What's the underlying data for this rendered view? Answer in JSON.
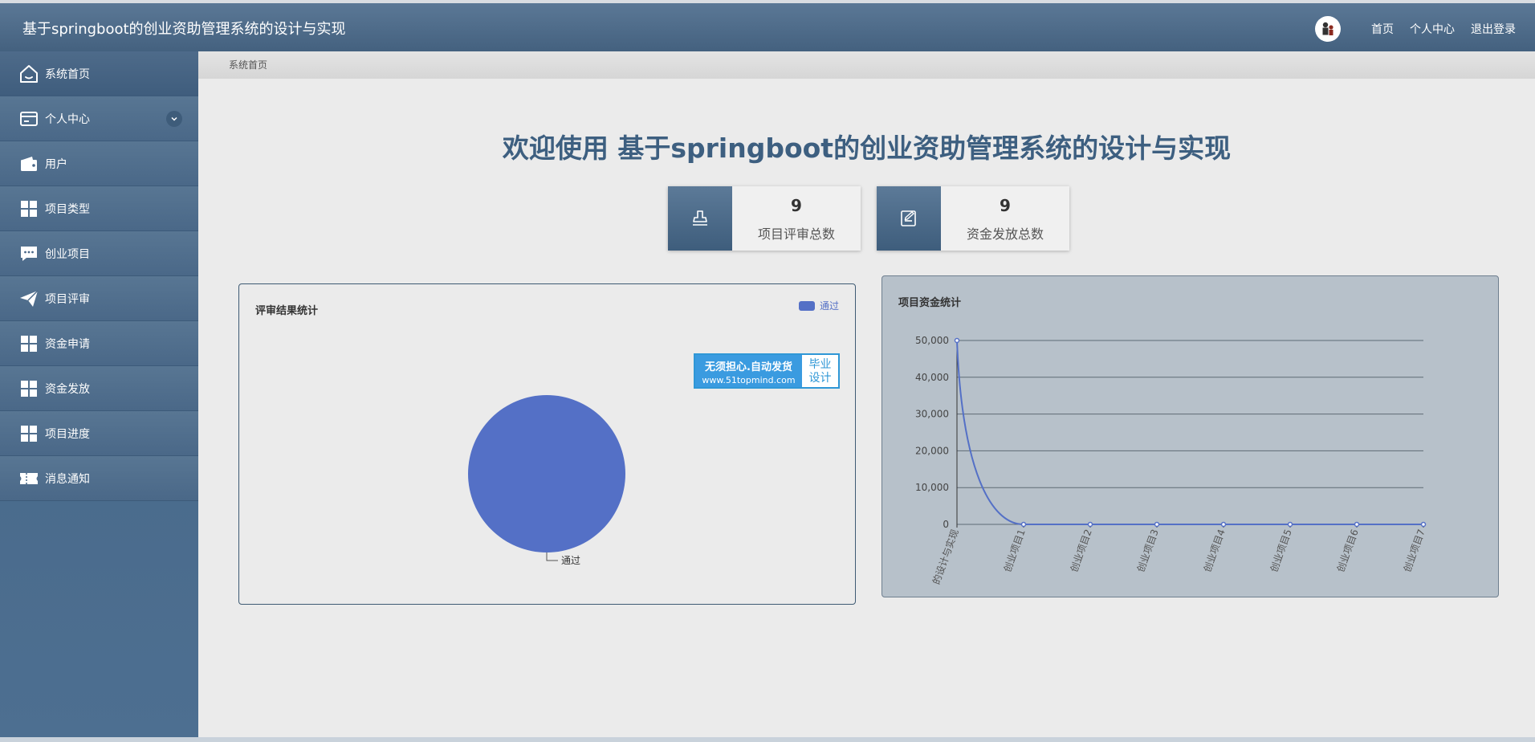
{
  "header": {
    "app_title": "基于springboot的创业资助管理系统的设计与实现",
    "nav": {
      "home": "首页",
      "profile": "个人中心",
      "logout": "退出登录"
    }
  },
  "sidebar": {
    "items": [
      {
        "label": "系统首页",
        "icon": "home-icon"
      },
      {
        "label": "个人中心",
        "icon": "card-icon",
        "expandable": true
      },
      {
        "label": "用户",
        "icon": "wallet-icon"
      },
      {
        "label": "项目类型",
        "icon": "grid-icon"
      },
      {
        "label": "创业项目",
        "icon": "chat-icon"
      },
      {
        "label": "项目评审",
        "icon": "paper-plane-icon"
      },
      {
        "label": "资金申请",
        "icon": "grid-icon"
      },
      {
        "label": "资金发放",
        "icon": "grid-icon"
      },
      {
        "label": "项目进度",
        "icon": "grid-icon"
      },
      {
        "label": "消息通知",
        "icon": "ticket-icon"
      }
    ]
  },
  "breadcrumb": "系统首页",
  "welcome": "欢迎使用 基于springboot的创业资助管理系统的设计与实现",
  "stats": [
    {
      "value": "9",
      "label": "项目评审总数",
      "icon": "stamp-icon"
    },
    {
      "value": "9",
      "label": "资金发放总数",
      "icon": "edit-note-icon"
    }
  ],
  "promo": {
    "line1": "无须担心.自动发货",
    "line2": "www.51topmind.com",
    "side1": "毕业",
    "side2": "设计"
  },
  "colors": {
    "accent": "#5470c6",
    "header": "#4a6888",
    "title": "#3d5f80"
  },
  "chart_data": [
    {
      "type": "pie",
      "title": "评审结果统计",
      "legend": [
        "通过"
      ],
      "legend_position": "top-right",
      "slices": [
        {
          "name": "通过",
          "value": 9
        }
      ]
    },
    {
      "type": "line",
      "title": "项目资金统计",
      "categories": [
        "的设计与实现",
        "创业项目1",
        "创业项目2",
        "创业项目3",
        "创业项目4",
        "创业项目5",
        "创业项目6",
        "创业项目7"
      ],
      "series": [
        {
          "values": [
            50000,
            0,
            0,
            0,
            0,
            0,
            0,
            0
          ]
        }
      ],
      "yticks": [
        "0",
        "10,000",
        "20,000",
        "30,000",
        "40,000",
        "50,000"
      ],
      "ylim": [
        0,
        50000
      ],
      "grid": true,
      "smooth": true
    }
  ]
}
